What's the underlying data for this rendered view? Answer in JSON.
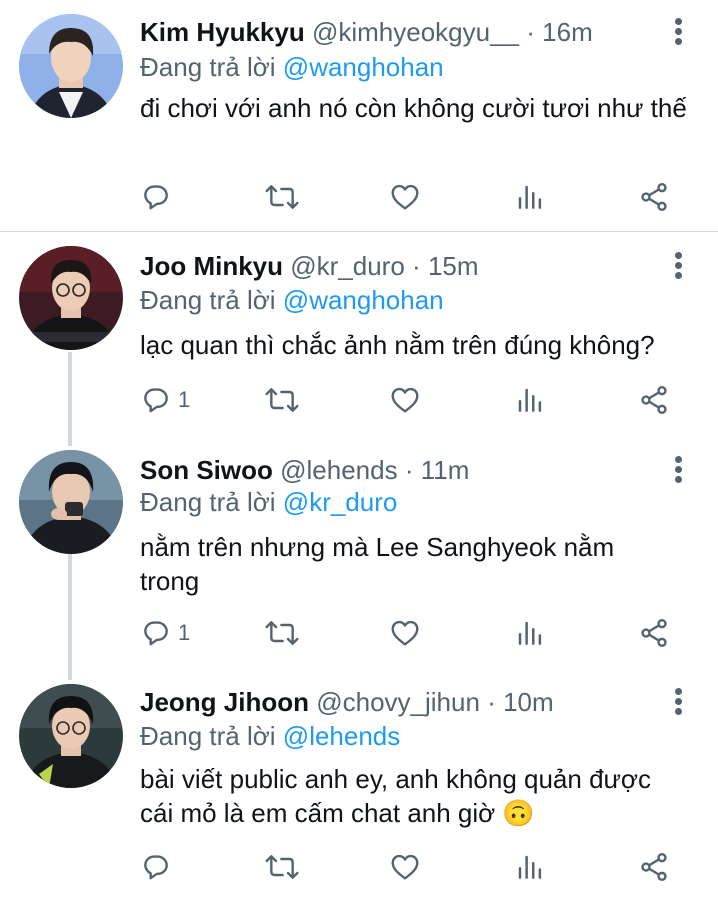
{
  "colors": {
    "accent": "#1d9bf0",
    "secondary_text": "#536471",
    "primary_text": "#0f1419",
    "divider": "#cfd9de"
  },
  "replying_label": "Đang trả lời",
  "tweets": [
    {
      "name": "Kim Hyukkyu",
      "handle": "@kimhyeokgyu__",
      "separator": "·",
      "time": "16m",
      "replying_to": "@wanghohan",
      "text": "đi chơi với anh nó còn không cười tươi như thế",
      "reply_count": ""
    },
    {
      "name": "Joo Minkyu",
      "handle": "@kr_duro",
      "separator": "·",
      "time": "15m",
      "replying_to": "@wanghohan",
      "text": "lạc quan thì chắc ảnh nằm trên đúng không?",
      "reply_count": "1"
    },
    {
      "name": "Son Siwoo",
      "handle": "@lehends",
      "separator": "·",
      "time": "11m",
      "replying_to": "@kr_duro",
      "text": "nằm trên nhưng mà Lee Sanghyeok nằm trong",
      "reply_count": "1"
    },
    {
      "name": "Jeong Jihoon",
      "handle": "@chovy_jihun",
      "separator": "·",
      "time": "10m",
      "replying_to": "@lehends",
      "text": "bài viết public anh ey, anh không quản được cái mỏ là em cấm chat anh giờ 🙃",
      "reply_count": ""
    }
  ],
  "icons": [
    "reply-icon",
    "retweet-icon",
    "like-icon",
    "analytics-icon",
    "share-icon",
    "more-icon"
  ]
}
